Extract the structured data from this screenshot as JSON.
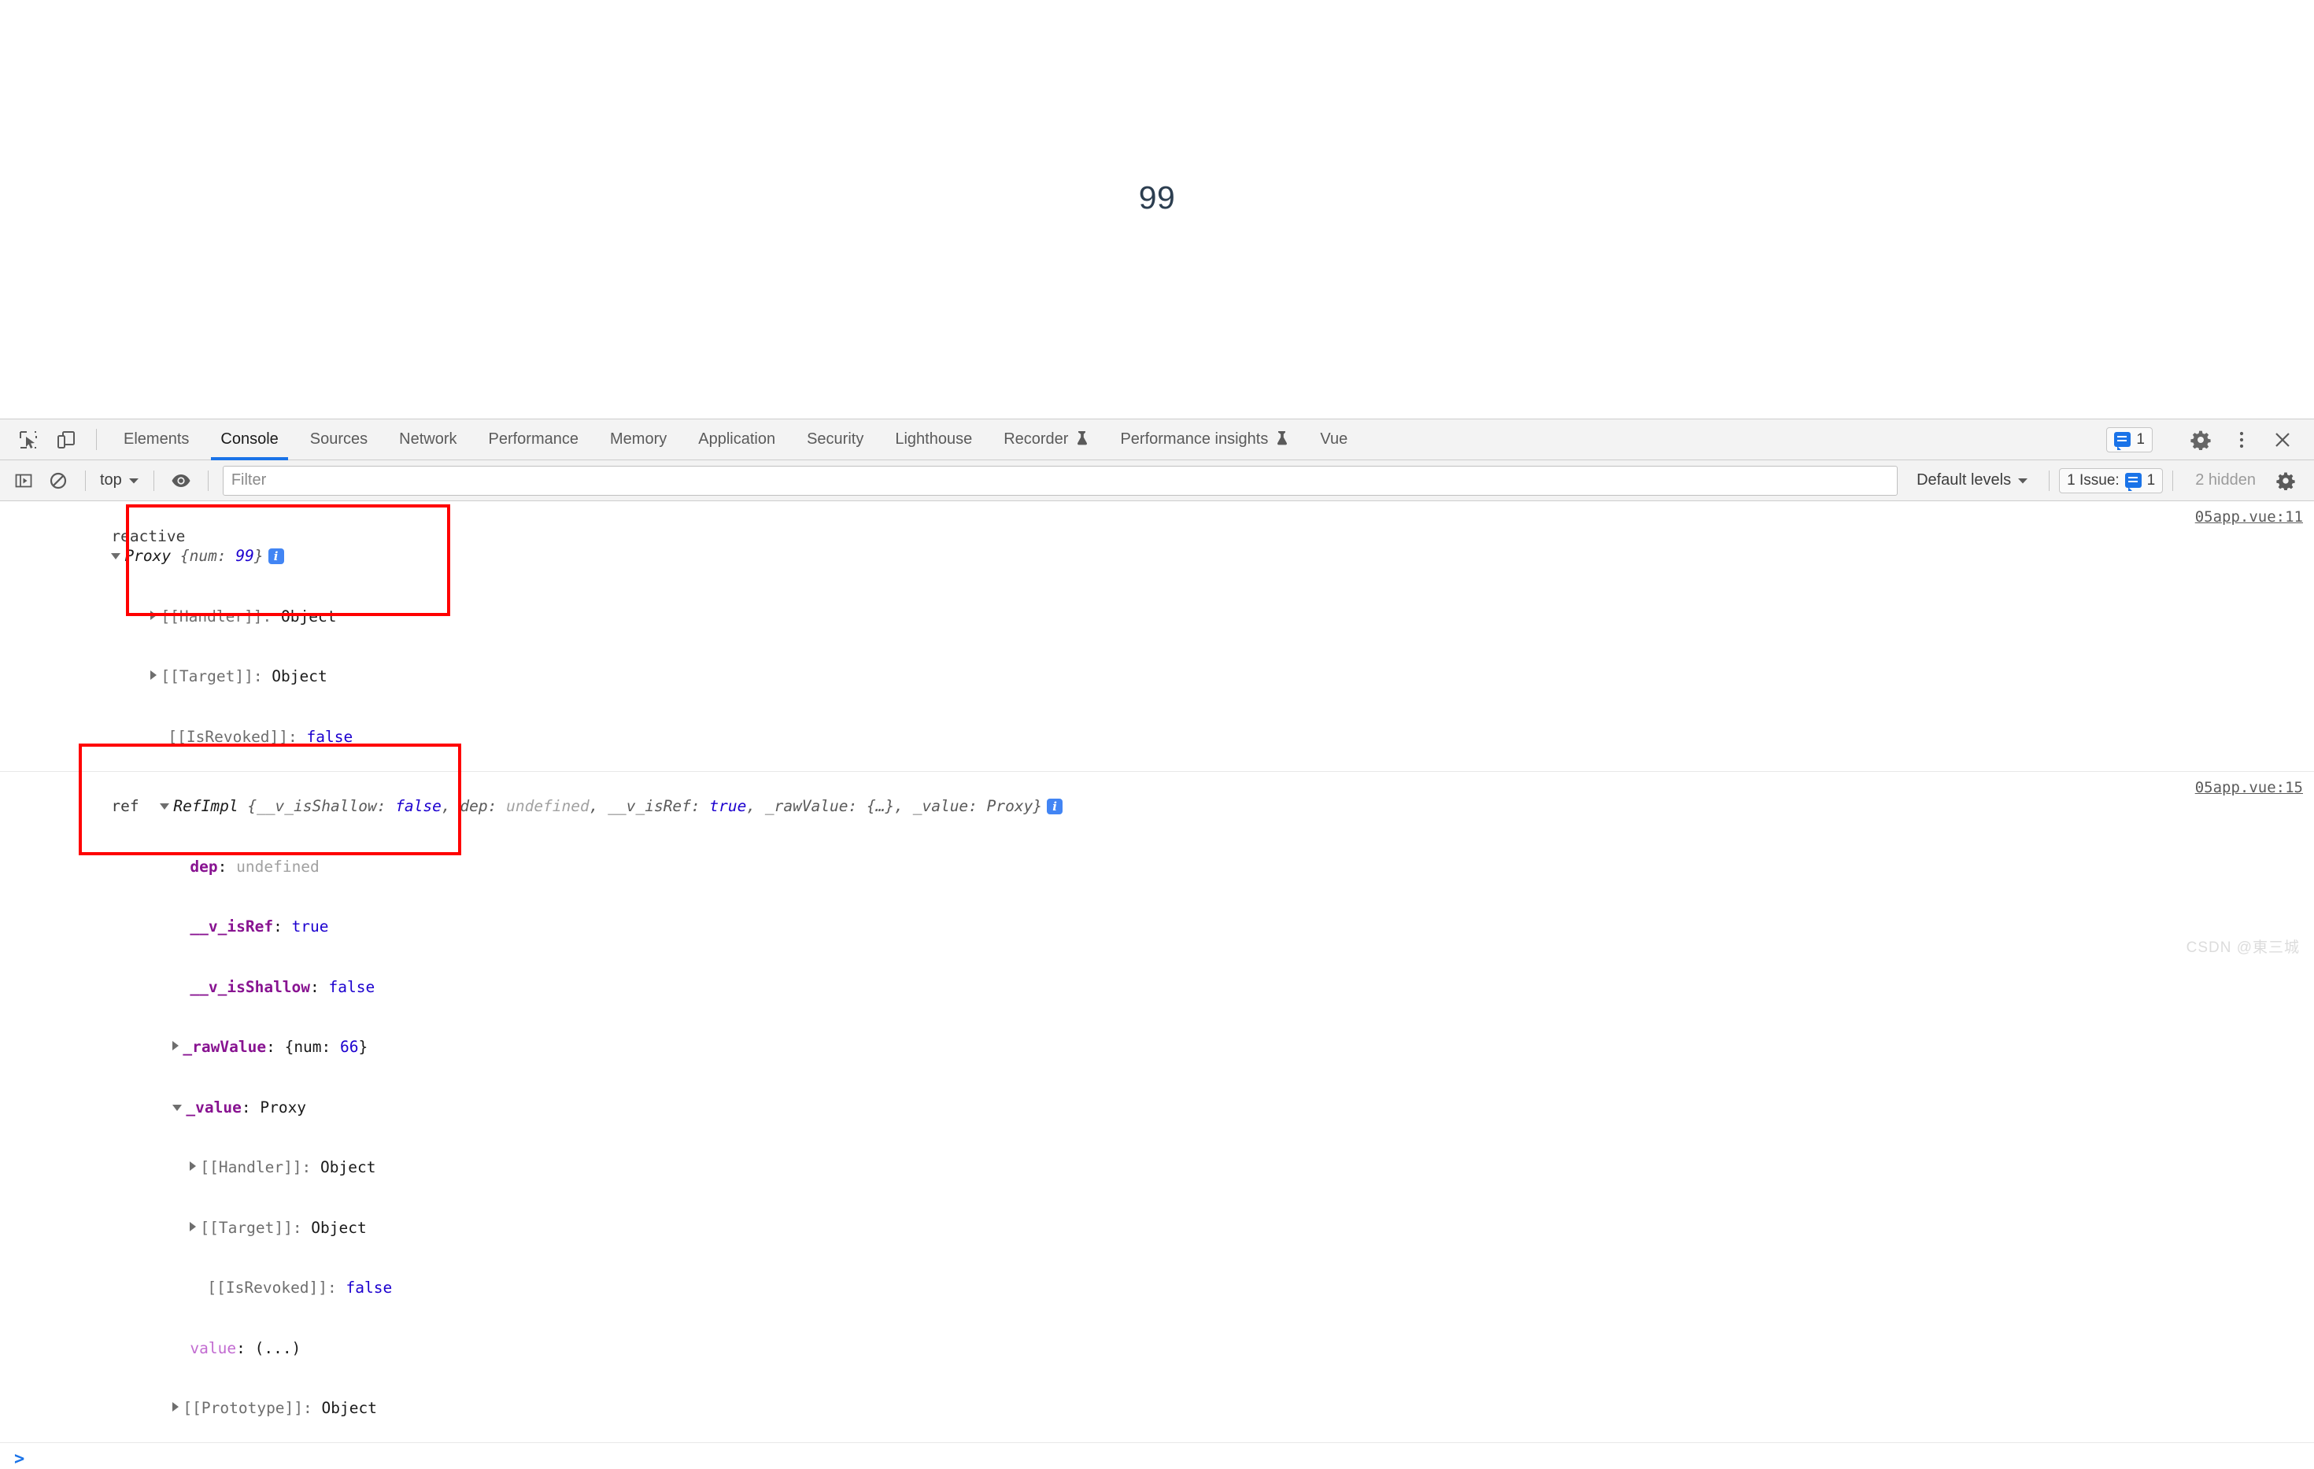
{
  "page": {
    "rendered_value": "99"
  },
  "devtools": {
    "left_icons": [
      {
        "name": "inspect-element-icon",
        "label": "Inspect element"
      },
      {
        "name": "device-toolbar-icon",
        "label": "Toggle device toolbar"
      }
    ],
    "tabs": [
      {
        "label": "Elements",
        "active": false,
        "experimental": false
      },
      {
        "label": "Console",
        "active": true,
        "experimental": false
      },
      {
        "label": "Sources",
        "active": false,
        "experimental": false
      },
      {
        "label": "Network",
        "active": false,
        "experimental": false
      },
      {
        "label": "Performance",
        "active": false,
        "experimental": false
      },
      {
        "label": "Memory",
        "active": false,
        "experimental": false
      },
      {
        "label": "Application",
        "active": false,
        "experimental": false
      },
      {
        "label": "Security",
        "active": false,
        "experimental": false
      },
      {
        "label": "Lighthouse",
        "active": false,
        "experimental": false
      },
      {
        "label": "Recorder",
        "active": false,
        "experimental": true
      },
      {
        "label": "Performance insights",
        "active": false,
        "experimental": true
      },
      {
        "label": "Vue",
        "active": false,
        "experimental": false
      }
    ],
    "tabstrip_right": {
      "issues_count": "1",
      "settings_icon": "gear-icon",
      "more_icon": "kebab-menu-icon",
      "close_icon": "close-icon"
    },
    "console_toolbar": {
      "sidebar_toggle_icon": "console-sidebar-icon",
      "clear_icon": "clear-console-icon",
      "context": "top",
      "eye_icon": "live-expression-eye-icon",
      "filter_placeholder": "Filter",
      "filter_value": "",
      "levels_label": "Default levels",
      "issue_label": "1 Issue:",
      "issue_count": "1",
      "hidden_label": "2 hidden",
      "settings_icon": "console-settings-gear-icon"
    },
    "messages": [
      {
        "label": "reactive",
        "source": "05app.vue:11",
        "header": {
          "class_name": "Proxy",
          "preview": "{num: 99}",
          "preview_key": "num",
          "preview_value": "99",
          "has_info_badge": true
        },
        "children": [
          {
            "key": "[[Handler]]",
            "value": "Object",
            "expandable": true,
            "kind": "internal"
          },
          {
            "key": "[[Target]]",
            "value": "Object",
            "expandable": true,
            "kind": "internal"
          },
          {
            "key": "[[IsRevoked]]",
            "value": "false",
            "expandable": false,
            "kind": "internal-bool"
          }
        ]
      },
      {
        "label": "ref",
        "source": "05app.vue:15",
        "header": {
          "class_name": "RefImpl",
          "preview_parts": [
            {
              "key": "__v_isShallow",
              "value": "false",
              "kind": "bool"
            },
            {
              "key": "dep",
              "value": "undefined",
              "kind": "undefined"
            },
            {
              "key": "__v_isRef",
              "value": "true",
              "kind": "bool"
            },
            {
              "key": "_rawValue",
              "value": "{…}",
              "kind": "object"
            },
            {
              "key": "_value",
              "value": "Proxy",
              "kind": "object"
            }
          ],
          "has_info_badge": true
        },
        "children": [
          {
            "key": "dep",
            "value": "undefined",
            "expandable": false,
            "kind": "undefined"
          },
          {
            "key": "__v_isRef",
            "value": "true",
            "expandable": false,
            "kind": "bool"
          },
          {
            "key": "__v_isShallow",
            "value": "false",
            "expandable": false,
            "kind": "bool"
          },
          {
            "key": "_rawValue",
            "value": "{num: 66}",
            "expandable": true,
            "kind": "object-preview",
            "preview_key": "num",
            "preview_value": "66"
          },
          {
            "key": "_value",
            "value": "Proxy",
            "expandable": true,
            "kind": "object",
            "expanded": true,
            "children": [
              {
                "key": "[[Handler]]",
                "value": "Object",
                "expandable": true,
                "kind": "internal"
              },
              {
                "key": "[[Target]]",
                "value": "Object",
                "expandable": true,
                "kind": "internal"
              },
              {
                "key": "[[IsRevoked]]",
                "value": "false",
                "expandable": false,
                "kind": "internal-bool"
              }
            ]
          },
          {
            "key": "value",
            "value": "(...)",
            "expandable": false,
            "kind": "accessor"
          },
          {
            "key": "[[Prototype]]",
            "value": "Object",
            "expandable": true,
            "kind": "internal"
          }
        ]
      }
    ],
    "prompt_caret": ">"
  },
  "annotations": [
    {
      "name": "highlight-box-proxy-internals",
      "color": "#ff0000"
    },
    {
      "name": "highlight-box-value-proxy-internals",
      "color": "#ff0000"
    }
  ],
  "watermark": "CSDN @東三城"
}
